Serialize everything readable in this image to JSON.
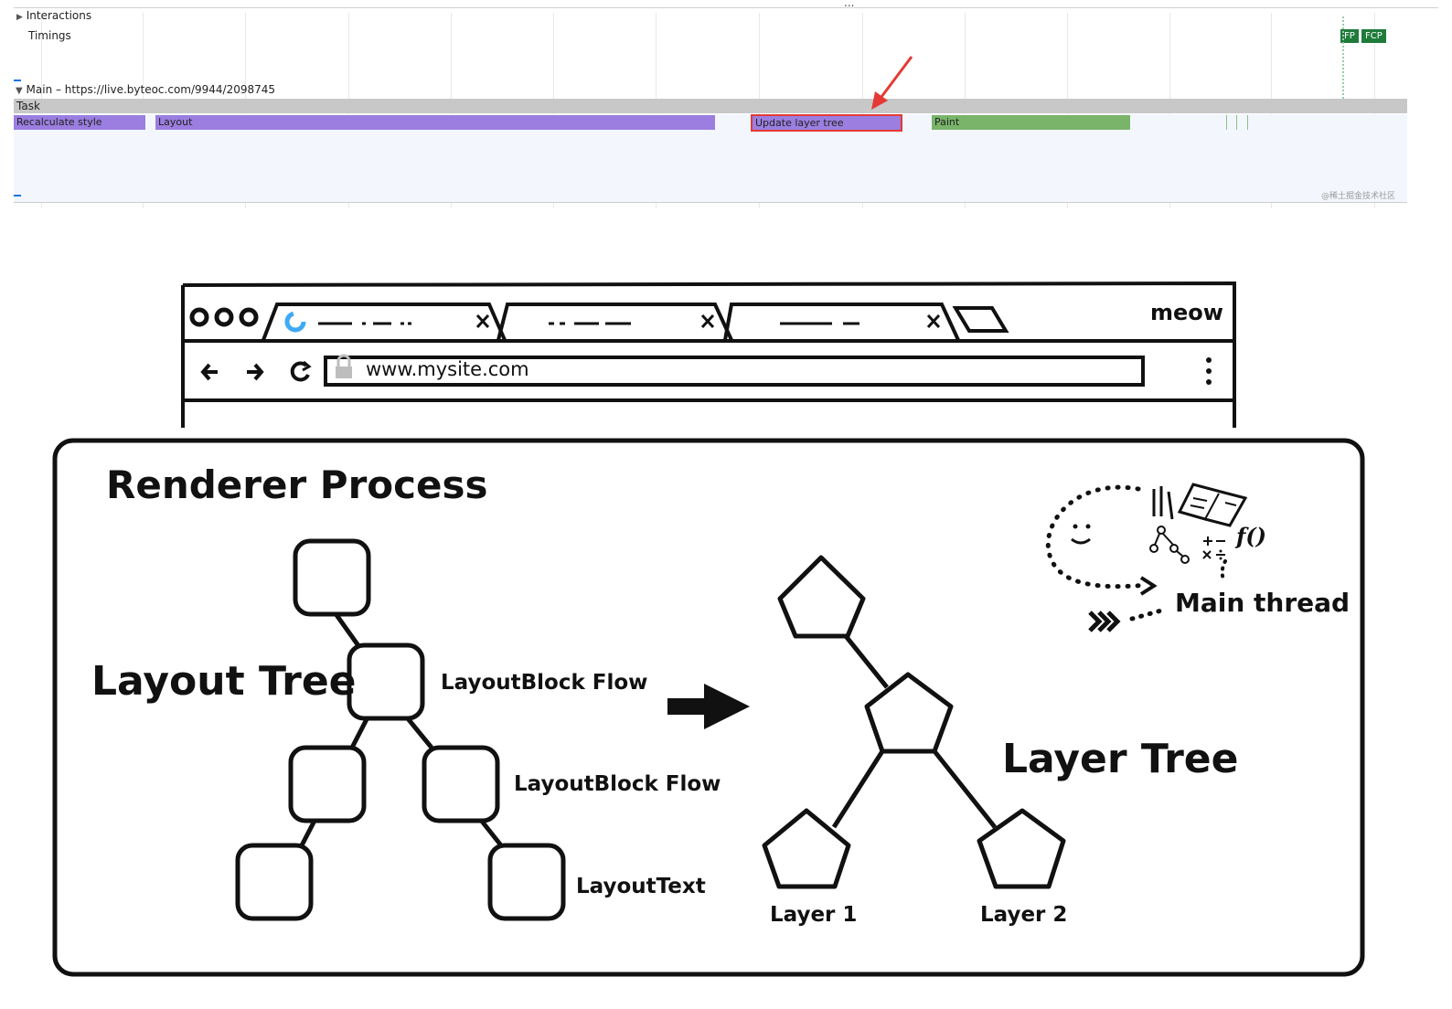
{
  "devtools": {
    "menu_dots": "...",
    "tracks": {
      "interactions": "Interactions",
      "timings": "Timings",
      "main": "Main – https://live.byteoc.com/9944/2098745"
    },
    "markers": {
      "fp": "FP",
      "fcp": "FCP"
    },
    "task_label": "Task",
    "events": [
      {
        "label": "Recalculate style",
        "color": "#9b7ee0"
      },
      {
        "label": "Layout",
        "color": "#9b7ee0"
      },
      {
        "label": "Update layer tree",
        "color": "#9b7ee0",
        "highlighted": true
      },
      {
        "label": "Paint",
        "color": "#79b46a"
      }
    ],
    "watermark": "@稀土掘金技术社区"
  },
  "browser": {
    "brand": "meow",
    "url": "www.mysite.com"
  },
  "renderer": {
    "title": "Renderer Process",
    "layout_tree_label": "Layout Tree",
    "node_labels": [
      "LayoutBlock Flow",
      "LayoutBlock Flow",
      "LayoutText"
    ],
    "layer_tree_label": "Layer Tree",
    "layers": [
      "Layer 1",
      "Layer 2"
    ],
    "main_thread_label": "Main thread",
    "fx_label": "f()"
  }
}
